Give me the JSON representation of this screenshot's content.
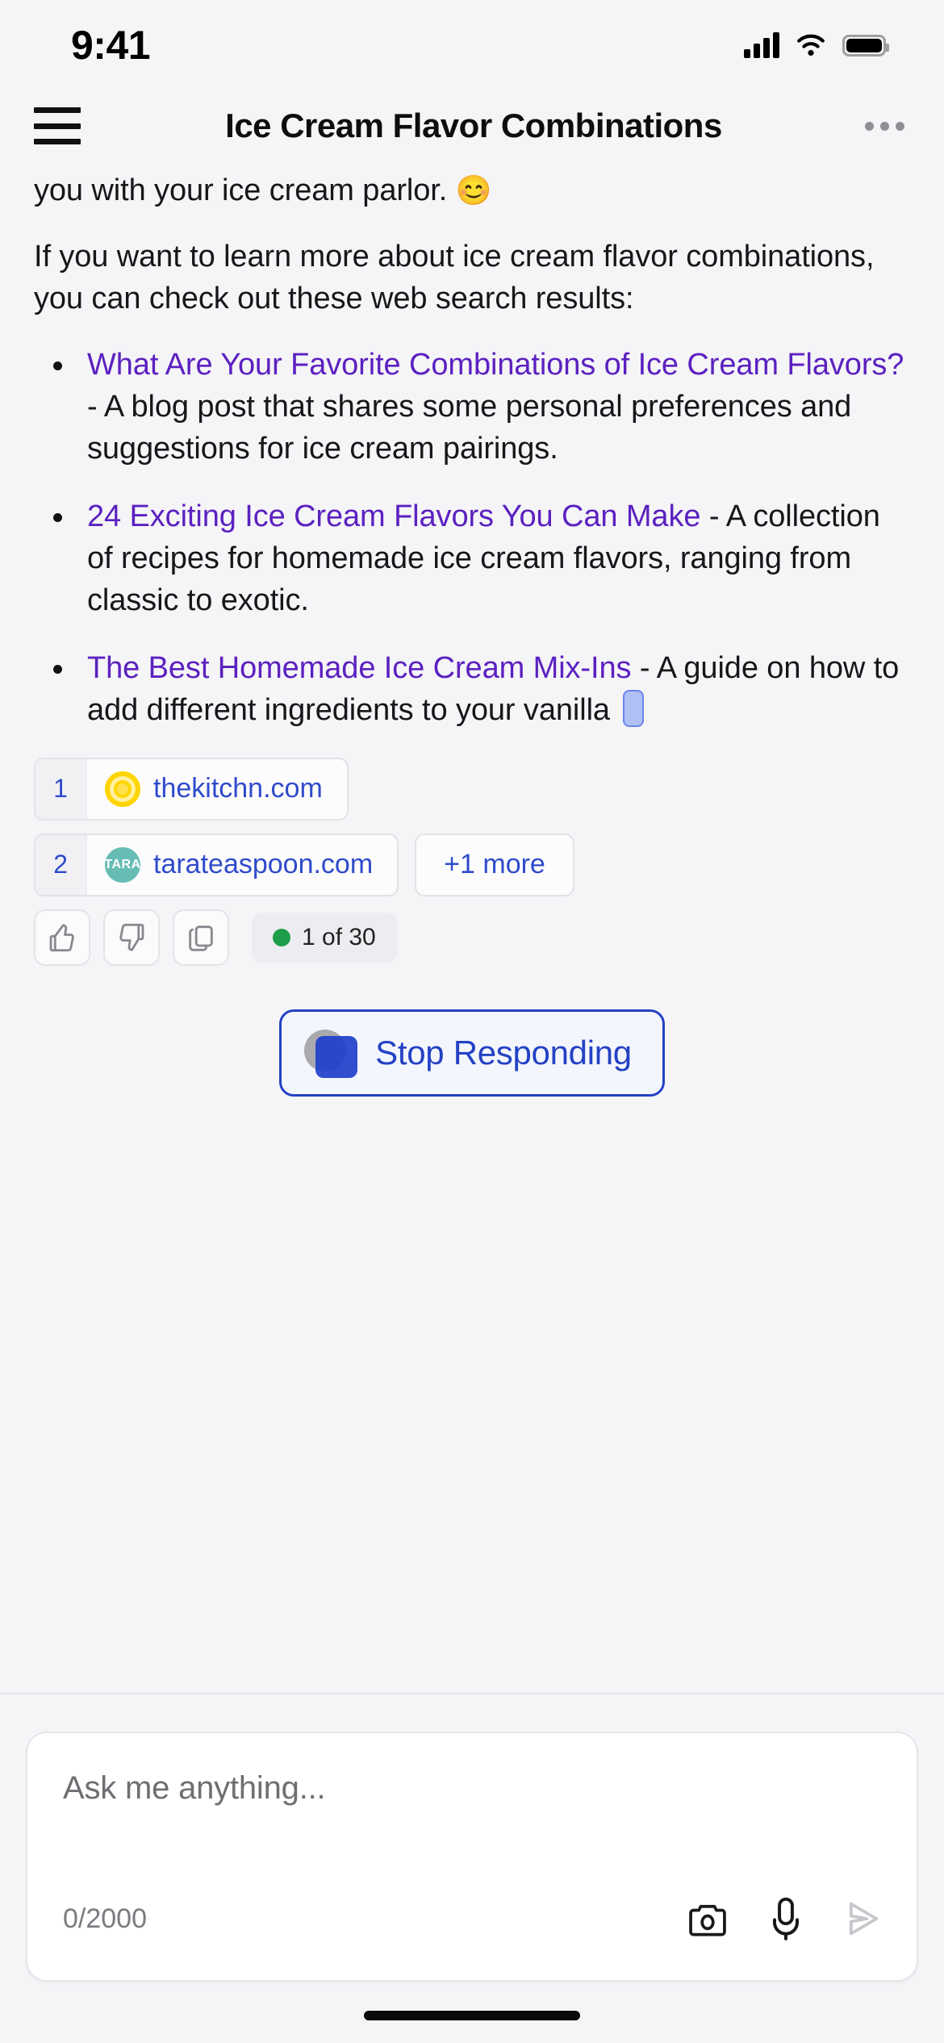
{
  "status_bar": {
    "time": "9:41",
    "cellular_icon": "signal-bars-icon",
    "wifi_icon": "wifi-icon",
    "battery_icon": "battery-icon"
  },
  "nav": {
    "menu_icon": "hamburger-menu-icon",
    "title": "Ice Cream Flavor Combinations",
    "overflow_icon": "more-options-icon"
  },
  "conversation": {
    "paragraph_1": "you with your ice cream parlor. ",
    "paragraph_1_emoji": "😊",
    "paragraph_2": "If you want to learn more about ice cream flavor combinations, you can check out these web search results:",
    "results": [
      {
        "link_text": "What Are Your Favorite Combinations of Ice Cream Flavors?",
        "description": " - A blog post that shares some personal preferences and suggestions for ice cream pairings."
      },
      {
        "link_text": "24 Exciting Ice Cream Flavors You Can Make",
        "description": " - A collection of recipes for homemade ice cream flavors, ranging from classic to exotic."
      },
      {
        "link_text": "The Best Homemade Ice Cream Mix-Ins",
        "description": " - A guide on how to add different ingredients to your vanilla "
      }
    ],
    "streaming_caret": "typing-caret"
  },
  "sources": [
    {
      "index": "1",
      "host": "thekitchn.com",
      "favicon": "thekitchn-favicon",
      "favicon_label": ""
    },
    {
      "index": "2",
      "host": "tarateaspoon.com",
      "favicon": "tarateaspoon-favicon",
      "favicon_label": "TARA"
    }
  ],
  "sources_more_label": "+1 more",
  "message_actions": {
    "thumbs_up_icon": "thumbs-up-icon",
    "thumbs_down_icon": "thumbs-down-icon",
    "copy_icon": "copy-icon",
    "counter_text": "1 of 30",
    "counter_dot_color": "#1E9E4A"
  },
  "stop_button": {
    "label": "Stop Responding",
    "icon": "stop-square-icon",
    "accent_color": "#2442C4"
  },
  "composer": {
    "placeholder": "Ask me anything...",
    "value": "",
    "char_count": "0/2000",
    "camera_icon": "camera-icon",
    "mic_icon": "microphone-icon",
    "send_icon": "send-icon"
  },
  "home_indicator": "home-indicator"
}
